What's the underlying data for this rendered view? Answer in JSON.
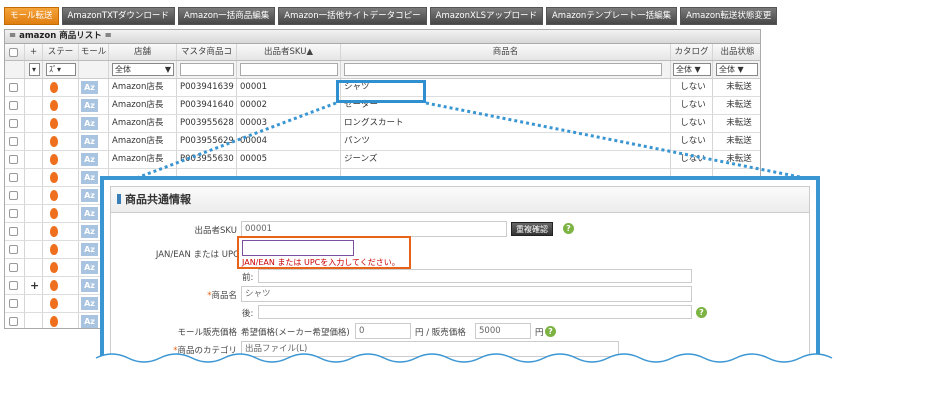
{
  "toolbar": [
    {
      "label": "モール転送",
      "active": true
    },
    {
      "label": "AmazonTXTダウンロード",
      "active": false
    },
    {
      "label": "Amazon一括商品編集",
      "active": false
    },
    {
      "label": "Amazon一括他サイトデータコピー",
      "active": false
    },
    {
      "label": "AmazonXLSアップロード",
      "active": false
    },
    {
      "label": "Amazonテンプレート一括編集",
      "active": false
    },
    {
      "label": "Amazon転送状態変更",
      "active": false
    }
  ],
  "list_title": "= amazon 商品リスト =",
  "columns": {
    "status": "ステー",
    "mall": "モール",
    "store": "店舗",
    "master": "マスタ商品コ",
    "sku": "出品者SKU",
    "name": "商品名",
    "catalog": "カタログ",
    "listing": "出品状態"
  },
  "filters": {
    "status": "ｽﾞ",
    "store": "全体",
    "catalog": "全体",
    "listing": "全体"
  },
  "rows": [
    {
      "store": "Amazon店長",
      "master": "P003941639",
      "sku": "00001",
      "name": "シャツ",
      "catalog": "しない",
      "listing": "未転送"
    },
    {
      "store": "Amazon店長",
      "master": "P003941640",
      "sku": "00002",
      "name": "セーター",
      "catalog": "しない",
      "listing": "未転送"
    },
    {
      "store": "Amazon店長",
      "master": "P003955628",
      "sku": "00003",
      "name": "ロングスカート",
      "catalog": "しない",
      "listing": "未転送"
    },
    {
      "store": "Amazon店長",
      "master": "P003955629",
      "sku": "00004",
      "name": "パンツ",
      "catalog": "しない",
      "listing": "未転送"
    },
    {
      "store": "Amazon店長",
      "master": "P003955630",
      "sku": "00005",
      "name": "ジーンズ",
      "catalog": "しない",
      "listing": "未転送"
    }
  ],
  "az_label": "Az",
  "plus": "+",
  "panel": {
    "title": "商品共通情報",
    "sku_label": "出品者SKU",
    "sku_value": "00001",
    "dup_button": "重複確認",
    "jan_label": "JAN/EAN または UPC",
    "jan_error": "JAN/EAN または UPCを入力してください。",
    "pre_label": "前:",
    "name_label": "商品名",
    "name_value": "シャツ",
    "post_label": "後:",
    "price_label": "モール販売価格",
    "list_price_label": "希望価格(メーカー希望価格)",
    "list_price_value": "0",
    "yen1": "円 / 販売価格",
    "sale_price_value": "5000",
    "yen2": "円",
    "category_label": "商品のカテゴリ",
    "category_value": "出品ファイル(L)",
    "req_mark": "*",
    "help": "?"
  },
  "colors": {
    "accent": "#3a96d3",
    "highlight": "#e8631a",
    "active": "#f08c1a"
  }
}
